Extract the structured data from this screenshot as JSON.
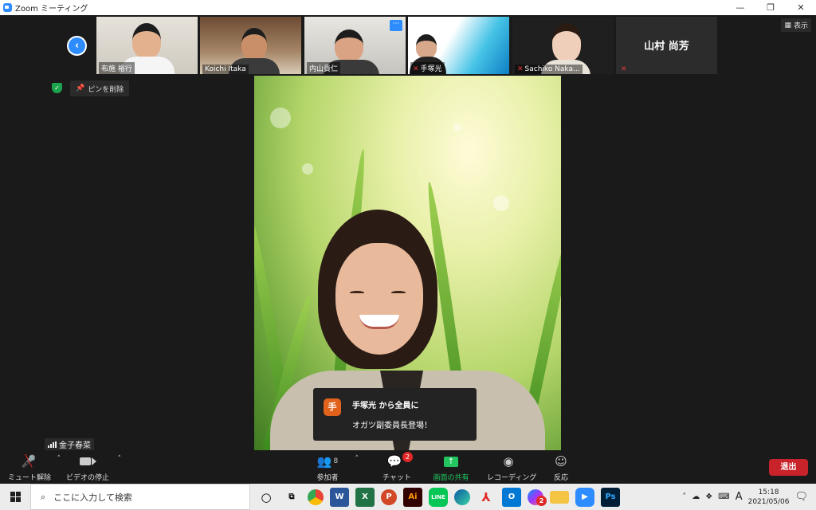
{
  "window": {
    "title": "Zoom ミーティング",
    "controls": {
      "minimize": "—",
      "restore": "❐",
      "close": "✕"
    }
  },
  "thumbnails": [
    {
      "name": "布施 裕行",
      "muted": false
    },
    {
      "name": "Koichi Itaka",
      "muted": false
    },
    {
      "name": "内山貴仁",
      "muted": false
    },
    {
      "name": "手塚光",
      "muted": true
    },
    {
      "name": "Sachiko Naka...",
      "muted": true
    },
    {
      "name": "山村 尚芳",
      "muted": true,
      "video_off": true
    }
  ],
  "view_button": {
    "label": "表示"
  },
  "thumb_more_label": "···",
  "unpin": {
    "label": "ピンを削除"
  },
  "chat_toast": {
    "avatar_letter": "手",
    "from": "手塚光 から全員に",
    "message": "オガツ副委員長登場！"
  },
  "self_name": "金子春菜",
  "toolbar": {
    "mute_label": "ミュート解除",
    "video_label": "ビデオの停止",
    "participants_label": "参加者",
    "participants_count": "8",
    "chat_label": "チャット",
    "chat_badge": "2",
    "share_label": "画面の共有",
    "record_label": "レコーディング",
    "reactions_label": "反応",
    "leave_label": "退出"
  },
  "taskbar": {
    "search_placeholder": "ここに入力して検索",
    "apps": [
      "chrome",
      "word",
      "excel",
      "powerpoint",
      "illustrator",
      "line",
      "edge",
      "acrobat",
      "outlook",
      "messenger",
      "explorer",
      "zoom",
      "photoshop"
    ],
    "messenger_badge": "2",
    "ime": "A",
    "time": "15:18",
    "date": "2021/05/06"
  },
  "colors": {
    "zoom_blue": "#2d8cff",
    "leave_red": "#c8232a",
    "share_green": "#22c55e"
  }
}
